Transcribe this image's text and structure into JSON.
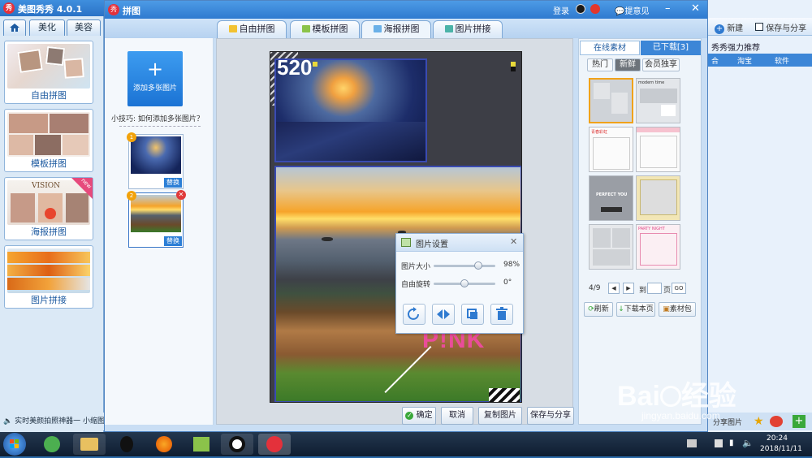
{
  "main_app": {
    "title": "美图秀秀 4.0.1",
    "logo": "秀",
    "tabs": [
      "美化",
      "美容"
    ],
    "modes": [
      {
        "label": "自由拼图"
      },
      {
        "label": "模板拼图"
      },
      {
        "label": "海报拼图",
        "badge": "new",
        "thumb_text": "VISION"
      },
      {
        "label": "图片拼接"
      }
    ],
    "status_text": "实时美颜拍照神器一 小缩图"
  },
  "right_app": {
    "new_label": "新建",
    "save_label": "保存与分享",
    "heading": "秀秀强力推荐",
    "tabs": [
      "合",
      "淘宝",
      "软件"
    ],
    "share_label": "分享图片"
  },
  "window": {
    "title": "拼图",
    "login": "登录",
    "feedback": "提意见",
    "tabs": [
      {
        "label": "自由拼图",
        "active": false
      },
      {
        "label": "模板拼图",
        "active": false
      },
      {
        "label": "海报拼图",
        "active": true
      },
      {
        "label": "图片拼接",
        "active": false
      }
    ]
  },
  "left_panel": {
    "add_button_plus": "+",
    "add_button_label": "添加多张图片",
    "tip": "小技巧: 如何添加多张图片？",
    "slots": [
      {
        "num": "1",
        "replace": "替换"
      },
      {
        "num": "2",
        "replace": "替换"
      }
    ]
  },
  "poster": {
    "number_text": "520",
    "brand_text": "P!NK"
  },
  "dialog": {
    "title": "图片设置",
    "rows": [
      {
        "label": "图片大小",
        "value": "98%",
        "level": 0.72
      },
      {
        "label": "自由旋转",
        "value": "0°",
        "level": 0.5
      }
    ]
  },
  "bottom_buttons": {
    "ok": "确定",
    "cancel": "取消",
    "copy": "复制图片",
    "save": "保存与分享"
  },
  "material_panel": {
    "tabs": [
      "在线素材",
      "已下载[3]"
    ],
    "sub_tabs": [
      "热门",
      "新鲜",
      "会员独享"
    ],
    "template_texts": [
      "modern time",
      "青春彩虹",
      "PERFECT YOU",
      "PARTY NIGHT"
    ],
    "page_indicator": "4/9",
    "goto_label": "到",
    "page_suffix": "页",
    "go_button": "GO",
    "refresh": "刷新",
    "download_page": "下载本页",
    "material_pack": "素材包"
  },
  "taskbar": {
    "time": "20:24",
    "date": "2018/11/11"
  },
  "watermark": {
    "brand": "Bai",
    "brand2": "经验",
    "url": "jingyan.baidu.com"
  },
  "colors": {
    "accent": "#2f7ad0",
    "poster_pink": "#ea4c9a",
    "selected_template": "#f0a21a"
  }
}
